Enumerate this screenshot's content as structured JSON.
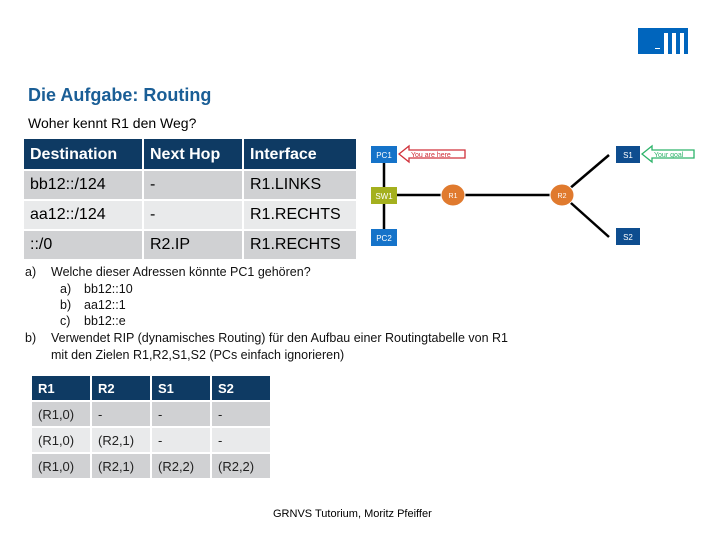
{
  "header": {
    "logo": "TUM",
    "title": "Die Aufgabe: Routing",
    "subtitle": "Woher kennt R1 den Weg?"
  },
  "routing_table": {
    "headers": [
      "Destination",
      "Next Hop",
      "Interface"
    ],
    "rows": [
      [
        "bb12::/124",
        "-",
        "R1.LINKS"
      ],
      [
        "aa12::/124",
        "-",
        "R1.RECHTS"
      ],
      [
        "::/0",
        "R2.IP",
        "R1.RECHTS"
      ]
    ]
  },
  "diagram": {
    "nodes": {
      "pc1": "PC1",
      "pc2": "PC2",
      "sw1": "SW1",
      "r1": "R1",
      "r2": "R2",
      "s1": "S1",
      "s2": "S2"
    },
    "callouts": {
      "you_are_here": "You are here",
      "your_goal": "Your goal"
    },
    "colors": {
      "pc": "#1573c9",
      "server": "#0e4d8f",
      "switch": "#a4b01e",
      "router": "#e07a2e",
      "here": "#d0303a",
      "goal": "#2db36a"
    }
  },
  "questions": {
    "a_marker": "a)",
    "a_text": "Welche dieser Adressen könnte PC1 gehören?",
    "options": [
      {
        "marker": "a)",
        "text": "bb12::10"
      },
      {
        "marker": "b)",
        "text": "aa12::1"
      },
      {
        "marker": "c)",
        "text": "bb12::e"
      }
    ],
    "b_marker": "b)",
    "b_line1": "Verwendet RIP (dynamisches Routing) für den Aufbau einer Routingtabelle von R1",
    "b_line2": "mit den Zielen R1,R2,S1,S2 (PCs einfach ignorieren)"
  },
  "rip_table": {
    "headers": [
      "R1",
      "R2",
      "S1",
      "S2"
    ],
    "rows": [
      [
        "(R1,0)",
        "-",
        "-",
        "-"
      ],
      [
        "(R1,0)",
        "(R2,1)",
        "-",
        "-"
      ],
      [
        "(R1,0)",
        "(R2,1)",
        "(R2,2)",
        "(R2,2)"
      ]
    ]
  },
  "footer": "GRNVS Tutorium, Moritz Pfeiffer"
}
